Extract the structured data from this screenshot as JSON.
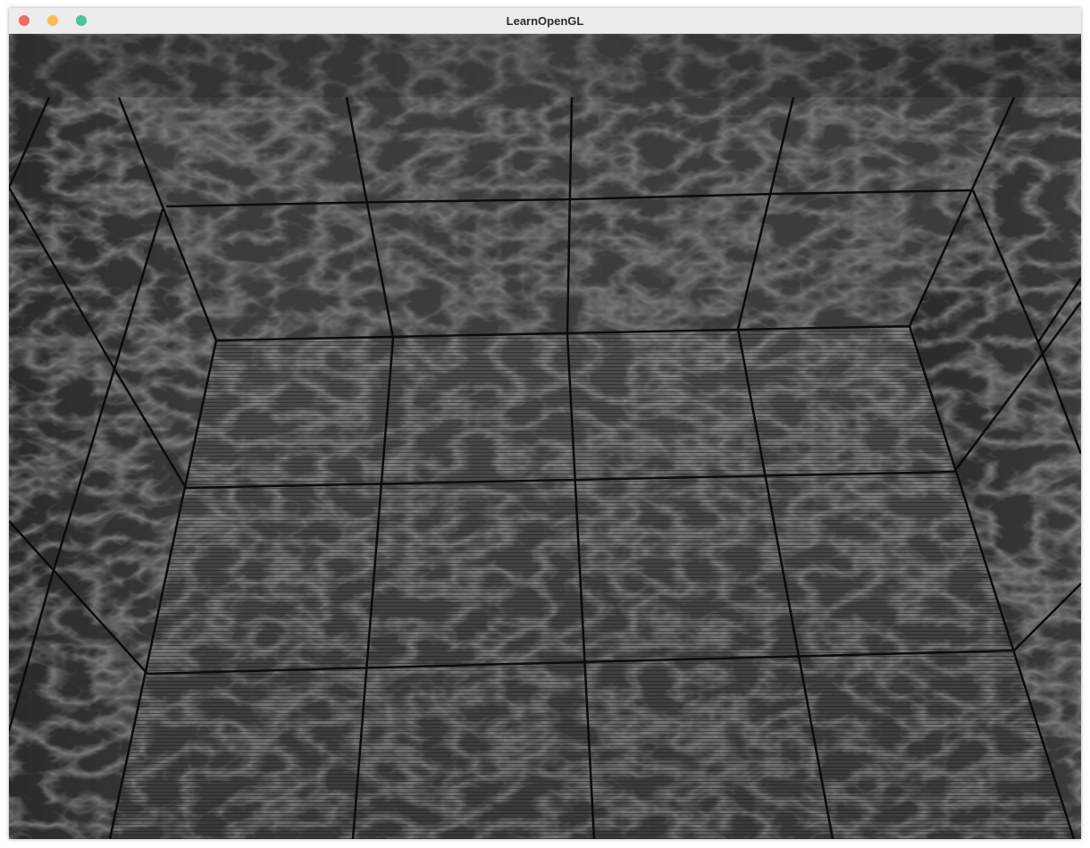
{
  "window": {
    "title": "LearnOpenGL",
    "buttons": [
      {
        "name": "close",
        "color": "#ee6a5f"
      },
      {
        "name": "minimize",
        "color": "#f5be4f"
      },
      {
        "name": "zoom",
        "color": "#47c4a0"
      }
    ]
  },
  "scene": {
    "description_colors": {
      "marble_dark": "#2b2b2b",
      "marble_mid": "#4a4a4a",
      "seam": "#0e0e0e"
    }
  }
}
